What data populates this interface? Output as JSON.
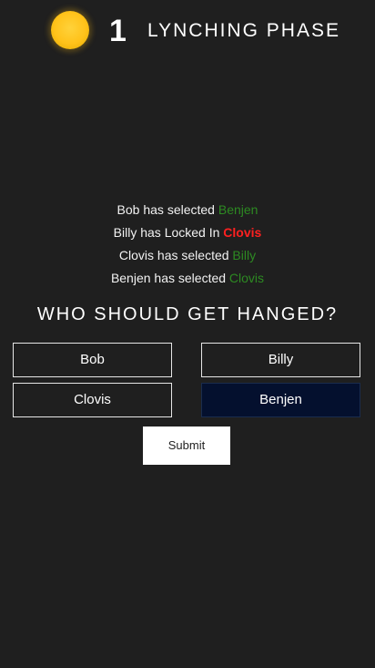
{
  "header": {
    "day_number": "1",
    "phase_title": "LYNCHING PHASE",
    "icon": "sun-icon"
  },
  "log": [
    {
      "actor": "Bob",
      "verb": " has selected ",
      "target": "Benjen",
      "type": "selected"
    },
    {
      "actor": "Billy",
      "verb": " has Locked In ",
      "target": "Clovis",
      "type": "locked"
    },
    {
      "actor": "Clovis",
      "verb": " has selected ",
      "target": "Billy",
      "type": "selected"
    },
    {
      "actor": "Benjen",
      "verb": " has selected ",
      "target": "Clovis",
      "type": "selected"
    }
  ],
  "question": "WHO SHOULD GET HANGED?",
  "candidates": [
    {
      "name": "Bob",
      "selected": false
    },
    {
      "name": "Billy",
      "selected": false
    },
    {
      "name": "Clovis",
      "selected": false
    },
    {
      "name": "Benjen",
      "selected": true
    }
  ],
  "submit_label": "Submit",
  "colors": {
    "background": "#1f1f1f",
    "selected_target": "#2d8a22",
    "locked_target": "#ff2020",
    "selected_button": "#04102e"
  }
}
